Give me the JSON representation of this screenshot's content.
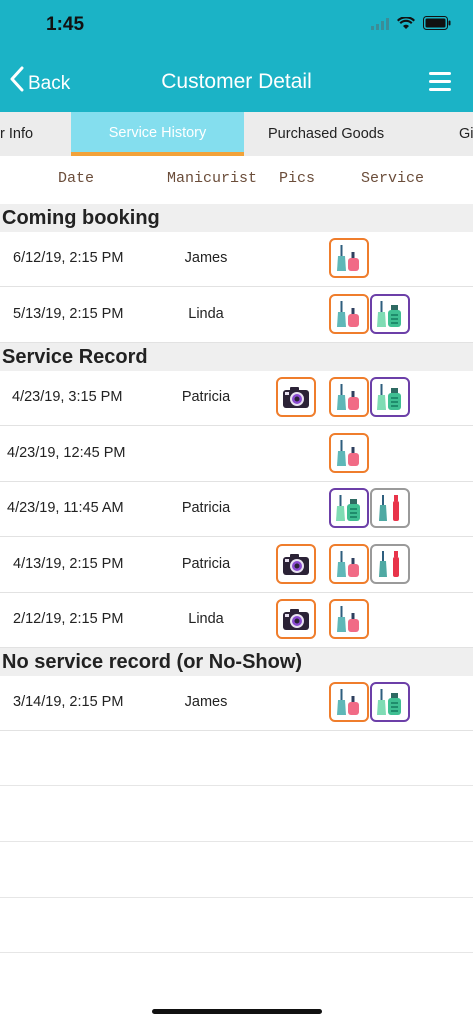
{
  "status": {
    "time": "1:45"
  },
  "nav": {
    "back_label": "Back",
    "title": "Customer Detail"
  },
  "tabs": [
    {
      "label": "r Info"
    },
    {
      "label": "Service History"
    },
    {
      "label": "Purchased Goods"
    },
    {
      "label": "Gi"
    }
  ],
  "columns": {
    "date": "Date",
    "manicurist": "Manicurist",
    "pics": "Pics",
    "service": "Service"
  },
  "sections": {
    "coming": "Coming booking",
    "record": "Service Record",
    "noshow": "No service record (or No-Show)"
  },
  "rows": [
    {
      "date": "6/12/19, 2:15 PM",
      "manicurist": "James",
      "pic": false,
      "services": [
        "polish-orange"
      ]
    },
    {
      "date": "5/13/19, 2:15 PM",
      "manicurist": "Linda",
      "pic": false,
      "services": [
        "polish-orange",
        "care-purple"
      ]
    },
    {
      "date": "4/23/19, 3:15 PM",
      "manicurist": "Patricia",
      "pic": true,
      "services": [
        "polish-orange",
        "care-purple"
      ]
    },
    {
      "date": "4/23/19, 12:45 PM",
      "manicurist": "",
      "pic": false,
      "services": [
        "polish-orange"
      ]
    },
    {
      "date": "4/23/19, 11:45 AM",
      "manicurist": "Patricia",
      "pic": false,
      "services": [
        "care-purple",
        "gel-gray"
      ]
    },
    {
      "date": "4/13/19, 2:15 PM",
      "manicurist": "Patricia",
      "pic": true,
      "services": [
        "polish-orange",
        "gel-gray"
      ]
    },
    {
      "date": "2/12/19, 2:15 PM",
      "manicurist": "Linda",
      "pic": true,
      "services": [
        "polish-orange"
      ]
    },
    {
      "date": "3/14/19, 2:15 PM",
      "manicurist": "James",
      "pic": false,
      "services": [
        "polish-orange",
        "care-purple"
      ]
    }
  ],
  "colors": {
    "header": "#1bb3c6",
    "tab_active": "#84deee",
    "tab_underline": "#f2a23a",
    "box_orange": "#ef7d2c",
    "box_purple": "#6c3fa8",
    "box_gray": "#9a9a9a"
  }
}
